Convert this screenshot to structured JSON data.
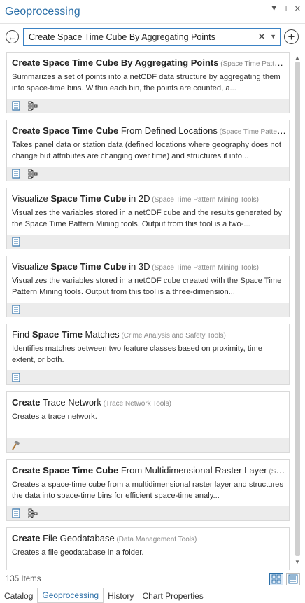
{
  "pane": {
    "title": "Geoprocessing",
    "menu_glyph": "▼",
    "pin_glyph": "⊥",
    "close_glyph": "✕"
  },
  "search": {
    "value": "Create Space Time Cube By Aggregating Points",
    "clear_glyph": "✕",
    "dropdown_glyph": "▼"
  },
  "toolbar": {
    "back_glyph": "←",
    "add_glyph": "+"
  },
  "results": [
    {
      "pre": "",
      "bold": "Create Space Time Cube By Aggregating Points",
      "post": "",
      "source": "(Space Time Pattern Mining Tools)",
      "desc": "Summarizes a set of points into a netCDF data structure by aggregating them into space-time bins.  Within each bin, the points are counted, a...",
      "icons": [
        "python-script-icon",
        "modelbuilder-icon"
      ]
    },
    {
      "pre": "",
      "bold": "Create Space Time Cube",
      "post": " From Defined Locations",
      "source": "(Space Time Pattern Mining Tools)",
      "desc": "Takes panel data or station data (defined locations where geography does not change but attributes are changing over time) and structures it into...",
      "icons": [
        "python-script-icon",
        "modelbuilder-icon"
      ]
    },
    {
      "pre": "Visualize ",
      "bold": "Space Time Cube",
      "post": " in 2D",
      "source": "(Space Time Pattern Mining Tools)",
      "desc": "Visualizes  the variables stored in a netCDF cube and the results generated by the Space Time Pattern Mining tools. Output from this tool is a two-...",
      "icons": [
        "python-script-icon"
      ]
    },
    {
      "pre": "Visualize ",
      "bold": "Space Time Cube",
      "post": " in 3D",
      "source": "(Space Time Pattern Mining Tools)",
      "desc": "Visualizes  the variables stored in a netCDF cube created with the Space Time Pattern Mining tools.  Output from this tool is a three-dimension...",
      "icons": [
        "python-script-icon"
      ]
    },
    {
      "pre": "Find ",
      "bold": "Space Time",
      "post": " Matches",
      "source": "(Crime Analysis and Safety Tools)",
      "desc": "Identifies matches between two feature classes based on proximity, time extent, or both.",
      "icons": [
        "python-script-icon"
      ]
    },
    {
      "pre": "",
      "bold": "Create",
      "post": " Trace Network",
      "source": "(Trace Network Tools)",
      "desc": "Creates a trace network.",
      "icons": [
        "system-tool-hammer-icon"
      ]
    },
    {
      "pre": "",
      "bold": "Create Space Time Cube",
      "post": " From Multidimensional Raster Layer",
      "source": "(Space Time Pattern Mining Tools)",
      "desc": "Creates a space-time cube from a  multidimensional raster layer and structures the data into space-time bins for efficient space-time analy...",
      "icons": [
        "python-script-icon",
        "modelbuilder-icon"
      ]
    },
    {
      "pre": "",
      "bold": "Create",
      "post": " File Geodatabase",
      "source": "(Data Management Tools)",
      "desc": "Creates a file geodatabase in a folder.",
      "icons": []
    }
  ],
  "status": {
    "item_count": "135 Items"
  },
  "tabs": [
    "Catalog",
    "Geoprocessing",
    "History",
    "Chart Properties"
  ],
  "active_tab": "Geoprocessing",
  "colors": {
    "accent": "#2b6fa8",
    "footer": "#ececec"
  }
}
